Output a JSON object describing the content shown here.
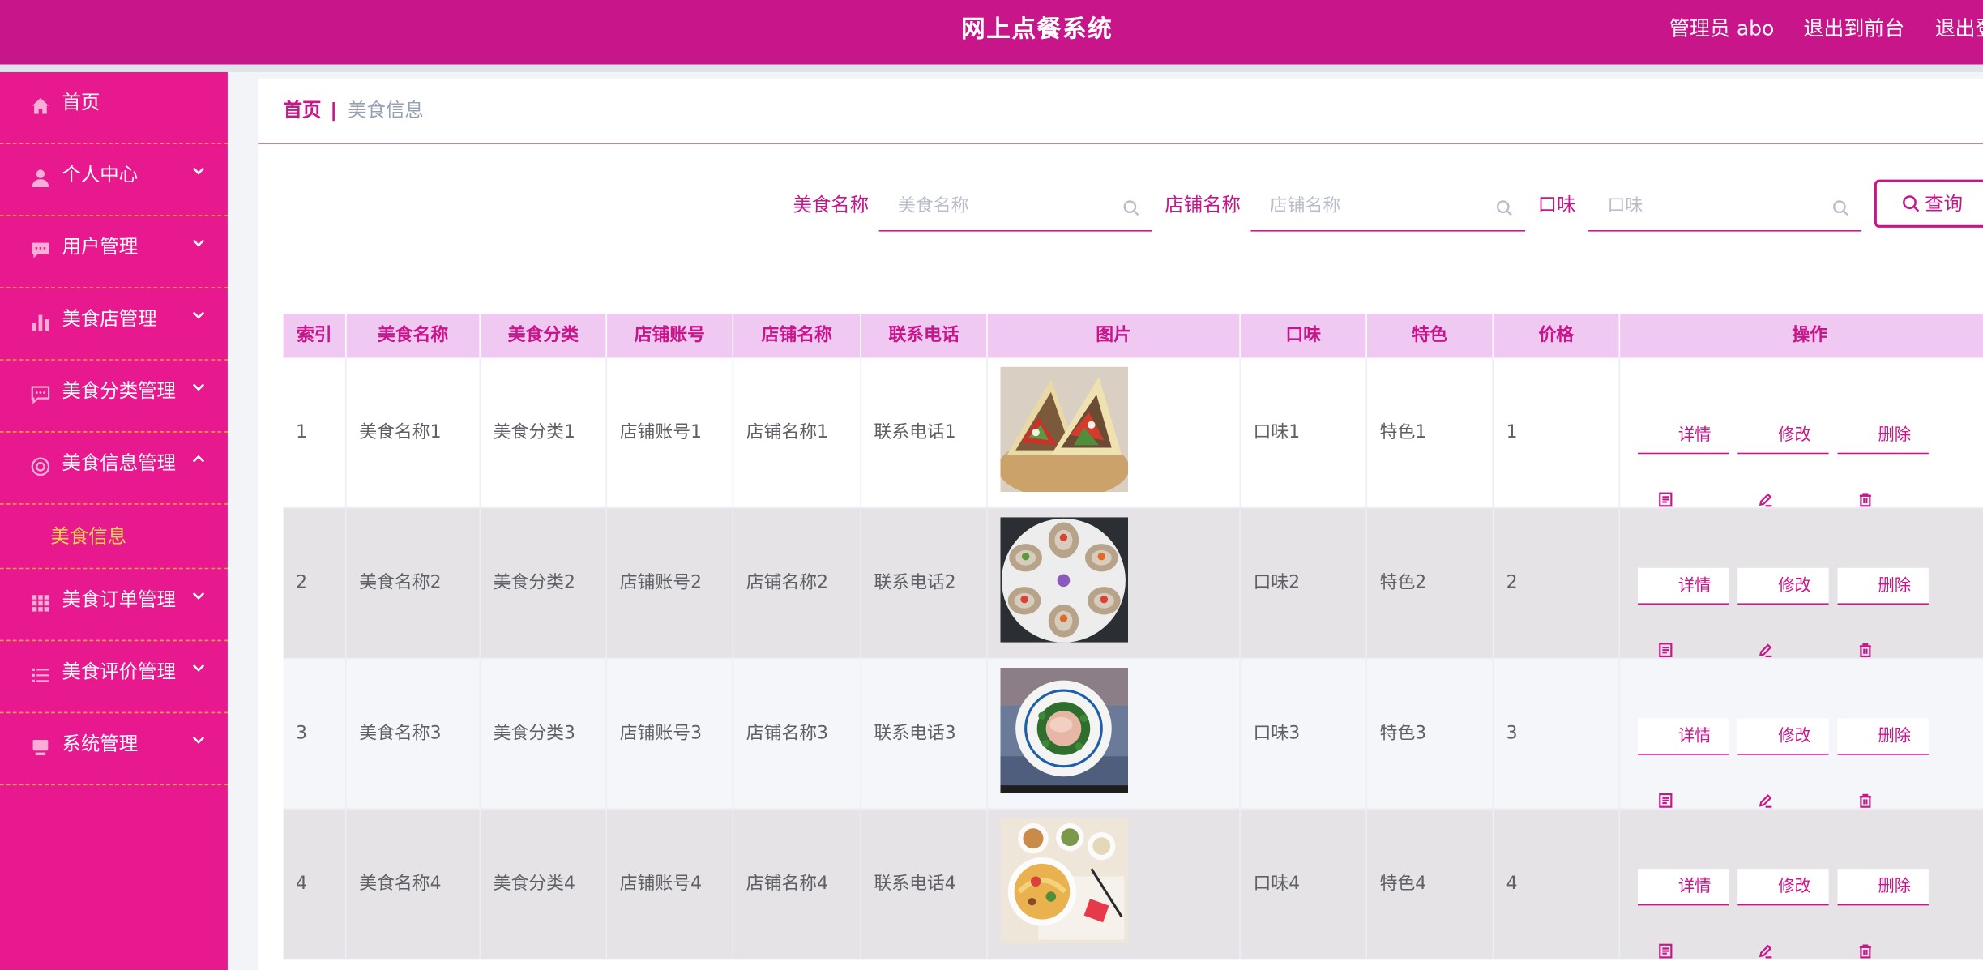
{
  "app": {
    "title": "网上点餐系统",
    "user_label": "管理员 abo",
    "front_label": "退出到前台",
    "logout_label": "退出登录"
  },
  "sidebar": {
    "items": [
      {
        "label": "首页",
        "icon": "home-icon",
        "arrow": "none"
      },
      {
        "label": "个人中心",
        "icon": "user-icon",
        "arrow": "down"
      },
      {
        "label": "用户管理",
        "icon": "chat-icon",
        "arrow": "down"
      },
      {
        "label": "美食店管理",
        "icon": "bar-chart-icon",
        "arrow": "down"
      },
      {
        "label": "美食分类管理",
        "icon": "message-icon",
        "arrow": "down"
      },
      {
        "label": "美食信息管理",
        "icon": "lifebuoy-icon",
        "arrow": "up"
      },
      {
        "label": "美食订单管理",
        "icon": "grid-icon",
        "arrow": "down"
      },
      {
        "label": "美食评价管理",
        "icon": "list-icon",
        "arrow": "down"
      },
      {
        "label": "系统管理",
        "icon": "monitor-icon",
        "arrow": "down"
      }
    ],
    "submenu_label": "美食信息"
  },
  "breadcrumb": {
    "home": "首页",
    "separator": "|",
    "current": "美食信息"
  },
  "search": {
    "name_label": "美食名称",
    "name_placeholder": "美食名称",
    "shop_label": "店铺名称",
    "shop_placeholder": "店铺名称",
    "taste_label": "口味",
    "taste_placeholder": "口味",
    "query_label": "查询"
  },
  "table": {
    "headers": [
      "索引",
      "美食名称",
      "美食分类",
      "店铺账号",
      "店铺名称",
      "联系电话",
      "图片",
      "口味",
      "特色",
      "价格",
      "操作"
    ],
    "rows": [
      {
        "index": "1",
        "name": "美食名称1",
        "category": "美食分类1",
        "account": "店铺账号1",
        "shop": "店铺名称1",
        "phone": "联系电话1",
        "image": "tacos",
        "taste": "口味1",
        "feature": "特色1",
        "price": "1"
      },
      {
        "index": "2",
        "name": "美食名称2",
        "category": "美食分类2",
        "account": "店铺账号2",
        "shop": "店铺名称2",
        "phone": "联系电话2",
        "image": "oysters",
        "taste": "口味2",
        "feature": "特色2",
        "price": "2"
      },
      {
        "index": "3",
        "name": "美食名称3",
        "category": "美食分类3",
        "account": "店铺账号3",
        "shop": "店铺名称3",
        "phone": "联系电话3",
        "image": "plated-dish",
        "taste": "口味3",
        "feature": "特色3",
        "price": "3"
      },
      {
        "index": "4",
        "name": "美食名称4",
        "category": "美食分类4",
        "account": "店铺账号4",
        "shop": "店铺名称4",
        "phone": "联系电话4",
        "image": "noodle-set",
        "taste": "口味4",
        "feature": "特色4",
        "price": "4"
      }
    ],
    "actions": {
      "detail": "详情",
      "edit": "修改",
      "delete": "删除"
    }
  },
  "colors": {
    "header_bg": "#c8168a",
    "sidebar_bg": "#e8198e",
    "accent": "#c8168a",
    "submenu_text": "#f7d74a",
    "table_head_bg": "#f0c9f2",
    "menu_divider": "#f3a037"
  }
}
